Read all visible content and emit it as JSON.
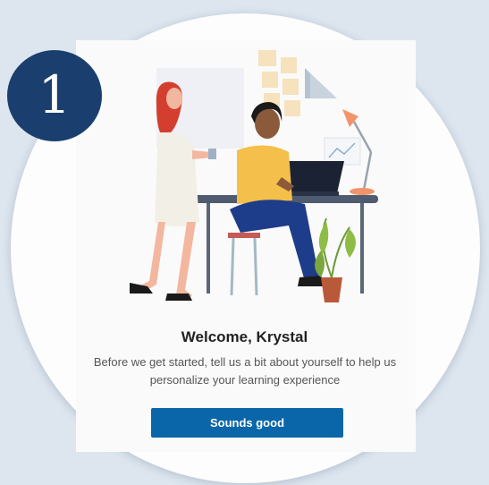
{
  "step": {
    "number": "1"
  },
  "welcome": {
    "title": "Welcome, Krystal",
    "subtitle": "Before we get started, tell us a bit about yourself to help us personalize your learning experience",
    "button_label": "Sounds good"
  },
  "colors": {
    "background": "#dde6ef",
    "badge": "#1a3f6e",
    "button": "#0a66a8"
  }
}
